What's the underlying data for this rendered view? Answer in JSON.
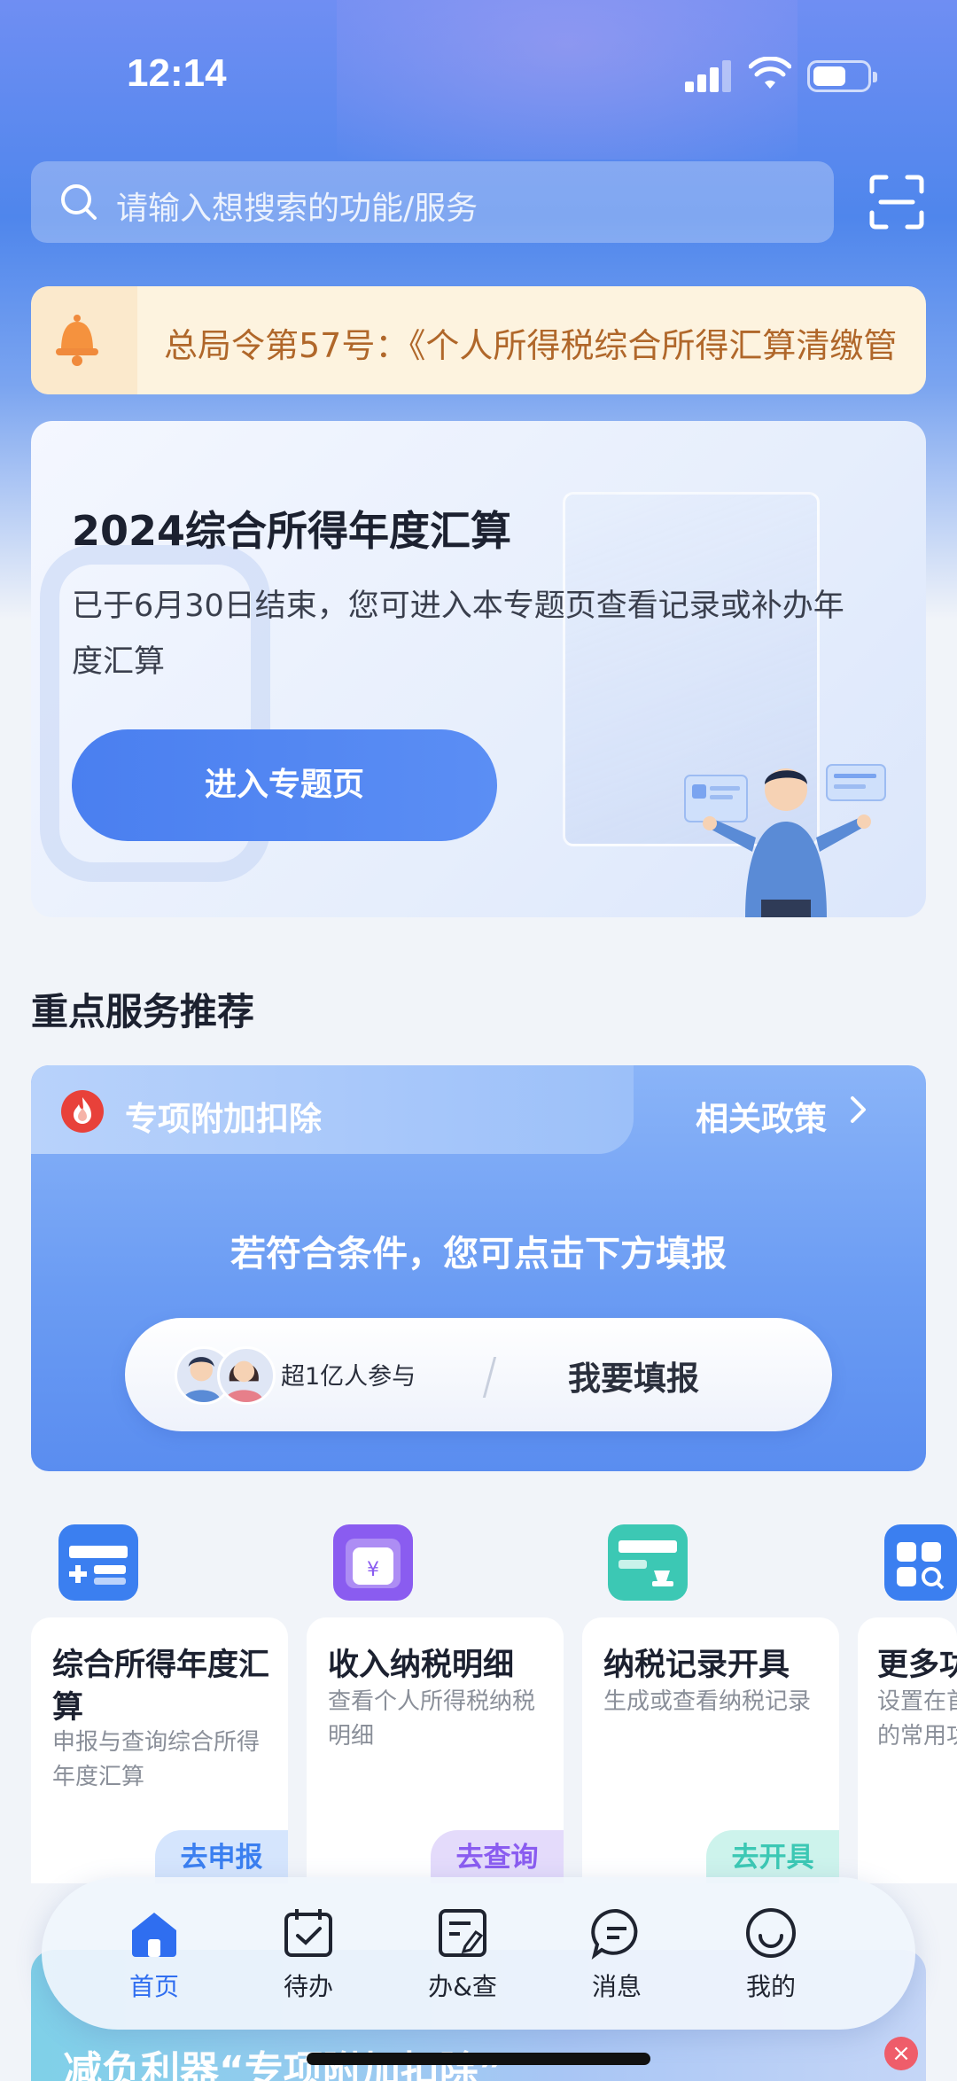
{
  "status_bar": {
    "time": "12:14"
  },
  "search": {
    "placeholder": "请输入想搜索的功能/服务"
  },
  "notice": {
    "text": "总局令第57号：《个人所得税综合所得汇算清缴管"
  },
  "banner": {
    "title": "2024综合所得年度汇算",
    "desc": "已于6月30日结束，您可进入本专题页查看记录或补办年度汇算",
    "button": "进入专题页"
  },
  "section": {
    "title": "重点服务推荐"
  },
  "deduction": {
    "title": "专项附加扣除",
    "policy_link": "相关政策",
    "prompt": "若符合条件，您可点击下方填报",
    "participants": "超1亿人参与",
    "fill_button": "我要填报"
  },
  "services": [
    {
      "title": "综合所得年度汇算",
      "desc": "申报与查询综合所得年度汇算",
      "action": "去申报",
      "icon": "annual-settlement-icon",
      "color": "#3b7ff0"
    },
    {
      "title": "收入纳税明细",
      "desc": "查看个人所得税纳税明细",
      "action": "去查询",
      "icon": "income-detail-icon",
      "color": "#8a5cf0"
    },
    {
      "title": "纳税记录开具",
      "desc": "生成或查看纳税记录",
      "action": "去开具",
      "icon": "tax-record-icon",
      "color": "#3cc8b4"
    },
    {
      "title": "更多功能",
      "desc": "设置在首页的常用功能",
      "action": "",
      "icon": "more-apps-icon",
      "color": "#3b7ff0"
    }
  ],
  "tabs": [
    {
      "label": "首页",
      "icon": "home-icon",
      "active": true
    },
    {
      "label": "待办",
      "icon": "calendar-check-icon",
      "active": false
    },
    {
      "label": "办&查",
      "icon": "document-edit-icon",
      "active": false
    },
    {
      "label": "消息",
      "icon": "message-icon",
      "active": false
    },
    {
      "label": "我的",
      "icon": "smile-icon",
      "active": false
    }
  ],
  "promo": {
    "text": "减负利器“专项附加扣除”"
  },
  "colors": {
    "primary": "#2f6ef0",
    "notice_text": "#b0672a",
    "notice_bg": "#fdf3df"
  }
}
